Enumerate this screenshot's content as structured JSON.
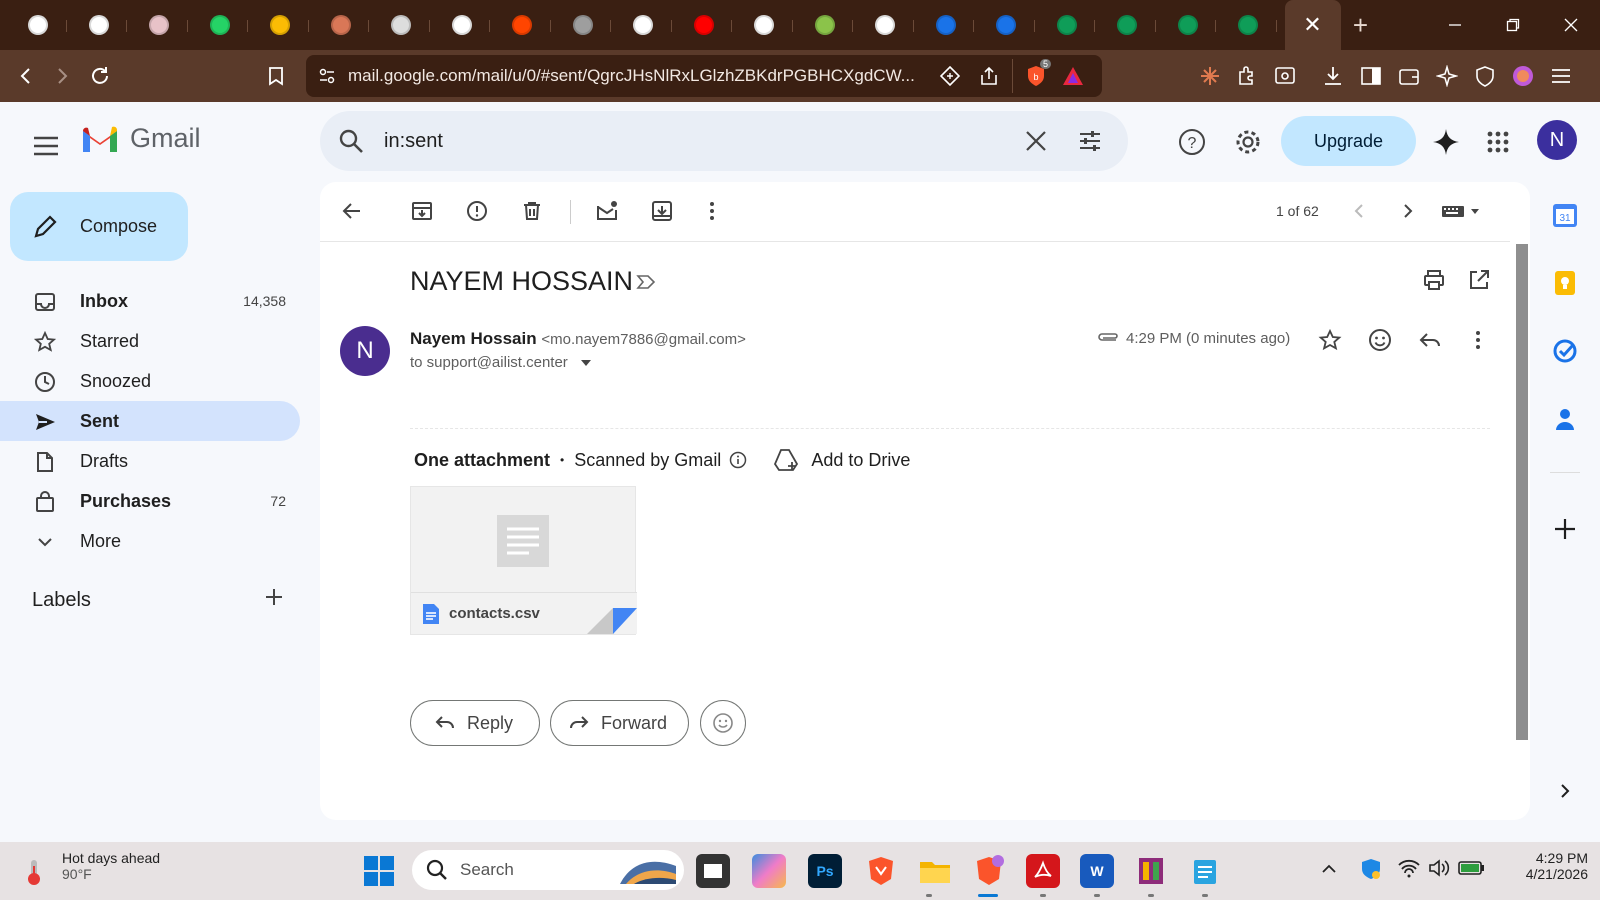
{
  "browser": {
    "url": "mail.google.com/mail/u/0/#sent/QgrcJHsNlRxLGlzhZBKdrPGBHCXgdCW...",
    "shield_badge": "5",
    "tabs": [
      {
        "icon": "google-icon",
        "color": "#ffffff"
      },
      {
        "icon": "chatgpt-icon",
        "color": "#ffffff"
      },
      {
        "icon": "image-tab-icon",
        "color": "#e8c2c8"
      },
      {
        "icon": "whatsapp-icon",
        "color": "#25d366"
      },
      {
        "icon": "drive-icon",
        "color": "#fbbc04"
      },
      {
        "icon": "claude-icon",
        "color": "#d97757"
      },
      {
        "icon": "tab-icon-7",
        "color": "#dddddd"
      },
      {
        "icon": "tab-icon-8",
        "color": "#ffffff"
      },
      {
        "icon": "reddit-icon",
        "color": "#ff4500"
      },
      {
        "icon": "globe-icon",
        "color": "#9e9e9e"
      },
      {
        "icon": "github-icon",
        "color": "#ffffff"
      },
      {
        "icon": "youtube-icon",
        "color": "#ff0000"
      },
      {
        "icon": "github-icon",
        "color": "#ffffff"
      },
      {
        "icon": "tab-icon-14",
        "color": "#8bc34a"
      },
      {
        "icon": "chatgpt-icon",
        "color": "#ffffff"
      },
      {
        "icon": "person-icon",
        "color": "#1a73e8"
      },
      {
        "icon": "person-icon",
        "color": "#1a73e8"
      },
      {
        "icon": "sheets-icon",
        "color": "#0f9d58"
      },
      {
        "icon": "sheets-icon",
        "color": "#0f9d58"
      },
      {
        "icon": "sheets-icon",
        "color": "#0f9d58"
      },
      {
        "icon": "sheets-icon",
        "color": "#0f9d58"
      }
    ]
  },
  "gmail": {
    "logo_text": "Gmail",
    "search_query": "in:sent",
    "upgrade_label": "Upgrade",
    "avatar_letter": "N",
    "compose_label": "Compose",
    "nav": [
      {
        "label": "Inbox",
        "count": "14,358"
      },
      {
        "label": "Starred",
        "count": ""
      },
      {
        "label": "Snoozed",
        "count": ""
      },
      {
        "label": "Sent",
        "count": ""
      },
      {
        "label": "Drafts",
        "count": ""
      },
      {
        "label": "Purchases",
        "count": "72"
      },
      {
        "label": "More",
        "count": ""
      }
    ],
    "labels_title": "Labels",
    "pager": "1 of 62",
    "subject": "NAYEM HOSSAIN",
    "sender_letter": "N",
    "sender_name": "Nayem Hossain",
    "sender_email": "<mo.nayem7886@gmail.com>",
    "to": "to support@ailist.center",
    "time": "4:29 PM (0 minutes ago)",
    "attachment_heading": "One attachment",
    "scanned_text": "Scanned by Gmail",
    "add_to_drive": "Add to Drive",
    "attachment_name": "contacts.csv",
    "reply_label": "Reply",
    "forward_label": "Forward",
    "accent": "#0b57d0"
  },
  "taskbar": {
    "weather_title": "Hot days ahead",
    "weather_temp": "90°F",
    "search_placeholder": "Search",
    "time": "4:29 PM",
    "date": "4/21/2026"
  }
}
